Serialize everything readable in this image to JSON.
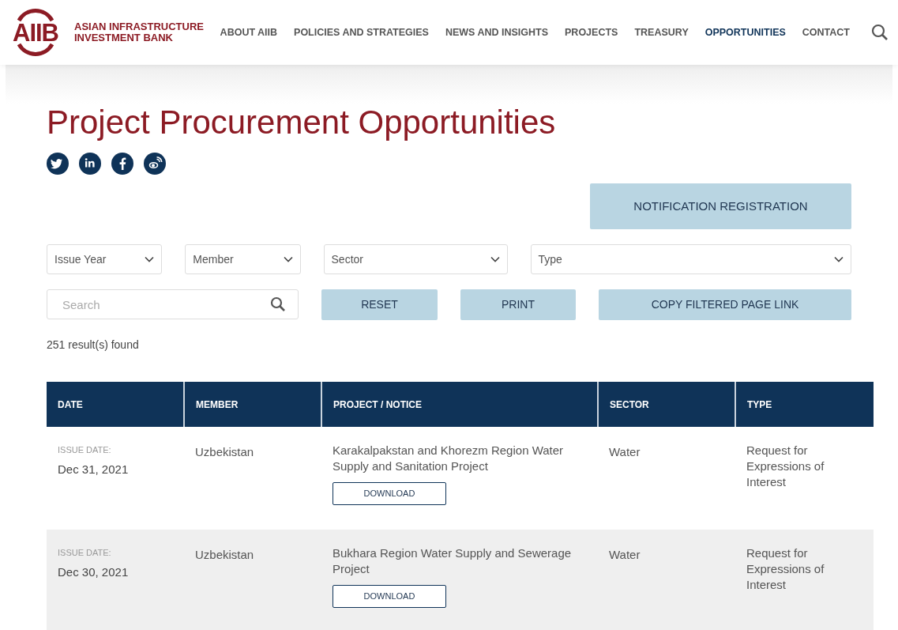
{
  "header": {
    "logo_mark": "AIIB",
    "logo_text": [
      "ASIAN INFRASTRUCTURE",
      "INVESTMENT BANK"
    ],
    "nav": [
      {
        "label": "ABOUT AIIB",
        "selected": false
      },
      {
        "label": "POLICIES AND STRATEGIES",
        "selected": false
      },
      {
        "label": "NEWS AND INSIGHTS",
        "selected": false
      },
      {
        "label": "PROJECTS",
        "selected": false
      },
      {
        "label": "TREASURY",
        "selected": false
      },
      {
        "label": "OPPORTUNITIES",
        "selected": true
      },
      {
        "label": "CONTACT",
        "selected": false
      }
    ]
  },
  "page_title": "Project Procurement Opportunities",
  "share": [
    {
      "kind": "twitter"
    },
    {
      "kind": "linkedin"
    },
    {
      "kind": "facebook"
    },
    {
      "kind": "weibo"
    }
  ],
  "notification_button": "NOTIFICATION REGISTRATION",
  "filters": [
    {
      "placeholder": "Issue Year"
    },
    {
      "placeholder": "Member"
    },
    {
      "placeholder": "Sector"
    },
    {
      "placeholder": "Type"
    }
  ],
  "search": {
    "placeholder": "Search"
  },
  "buttons": [
    "RESET",
    "PRINT",
    "COPY FILTERED PAGE LINK"
  ],
  "result_count": "251 result(s) found",
  "table": {
    "columns": [
      "DATE",
      "MEMBER",
      "PROJECT / NOTICE",
      "SECTOR",
      "TYPE"
    ],
    "rows": [
      {
        "date_label": "ISSUE DATE:",
        "date": "Dec 31, 2021",
        "member": "Uzbekistan",
        "project": "Karakalpakstan and Khorezm Region Water Supply and Sanitation Project",
        "action": "DOWNLOAD",
        "sector": "Water",
        "type": "Request for Expressions of Interest"
      },
      {
        "date_label": "ISSUE DATE:",
        "date": "Dec 30, 2021",
        "member": "Uzbekistan",
        "project": "Bukhara Region Water Supply and Sewerage Project",
        "action": "DOWNLOAD",
        "sector": "Water",
        "type": "Request for Expressions of Interest"
      }
    ]
  }
}
